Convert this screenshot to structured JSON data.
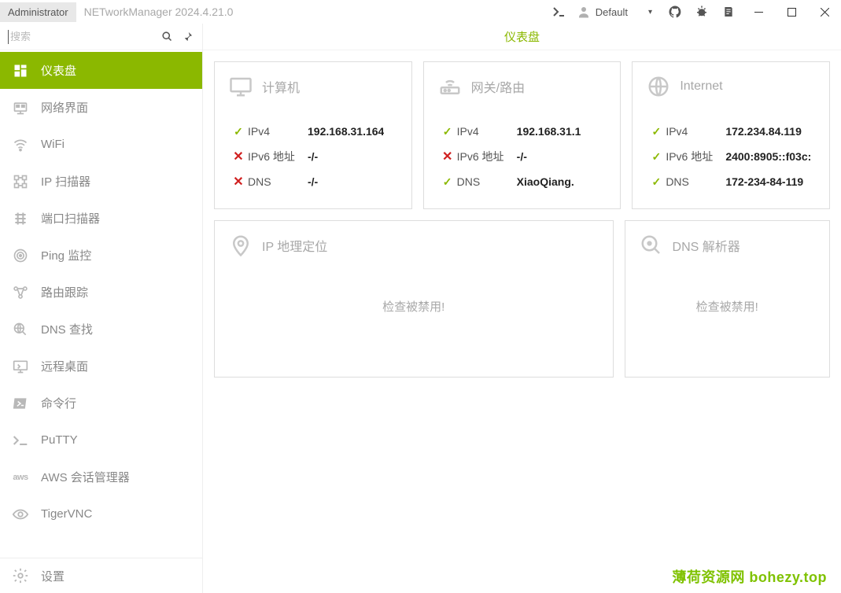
{
  "titlebar": {
    "admin_label": "Administrator",
    "app_title": "NETworkManager 2024.4.21.0",
    "profile_name": "Default"
  },
  "search": {
    "placeholder": "搜索"
  },
  "nav": {
    "items": [
      {
        "label": "仪表盘",
        "icon": "dashboard",
        "active": true
      },
      {
        "label": "网络界面",
        "icon": "network-interface"
      },
      {
        "label": "WiFi",
        "icon": "wifi"
      },
      {
        "label": "IP 扫描器",
        "icon": "ip-scanner"
      },
      {
        "label": "端口扫描器",
        "icon": "port-scanner"
      },
      {
        "label": "Ping 监控",
        "icon": "ping"
      },
      {
        "label": "路由跟踪",
        "icon": "traceroute"
      },
      {
        "label": "DNS 查找",
        "icon": "dns-lookup"
      },
      {
        "label": "远程桌面",
        "icon": "remote-desktop"
      },
      {
        "label": "命令行",
        "icon": "powershell"
      },
      {
        "label": "PuTTY",
        "icon": "putty"
      },
      {
        "label": "AWS 会话管理器",
        "icon": "aws"
      },
      {
        "label": "TigerVNC",
        "icon": "tigervnc"
      }
    ],
    "settings_label": "设置"
  },
  "page": {
    "title": "仪表盘"
  },
  "cards": {
    "computer": {
      "title": "计算机",
      "rows": [
        {
          "status": "ok",
          "label": "IPv4",
          "value": "192.168.31.164"
        },
        {
          "status": "fail",
          "label": "IPv6 地址",
          "value": "-/-"
        },
        {
          "status": "fail",
          "label": "DNS",
          "value": "-/-"
        }
      ]
    },
    "gateway": {
      "title": "网关/路由",
      "rows": [
        {
          "status": "ok",
          "label": "IPv4",
          "value": "192.168.31.1"
        },
        {
          "status": "fail",
          "label": "IPv6 地址",
          "value": "-/-"
        },
        {
          "status": "ok",
          "label": "DNS",
          "value": "XiaoQiang."
        }
      ]
    },
    "internet": {
      "title": "Internet",
      "rows": [
        {
          "status": "ok",
          "label": "IPv4",
          "value": "172.234.84.119"
        },
        {
          "status": "ok",
          "label": "IPv6 地址",
          "value": "2400:8905::f03c:"
        },
        {
          "status": "ok",
          "label": "DNS",
          "value": "172-234-84-119"
        }
      ]
    },
    "geo": {
      "title": "IP 地理定位",
      "message": "检查被禁用!"
    },
    "dnsres": {
      "title": "DNS 解析器",
      "message": "检查被禁用!"
    }
  },
  "watermark": "薄荷资源网  bohezy.top"
}
